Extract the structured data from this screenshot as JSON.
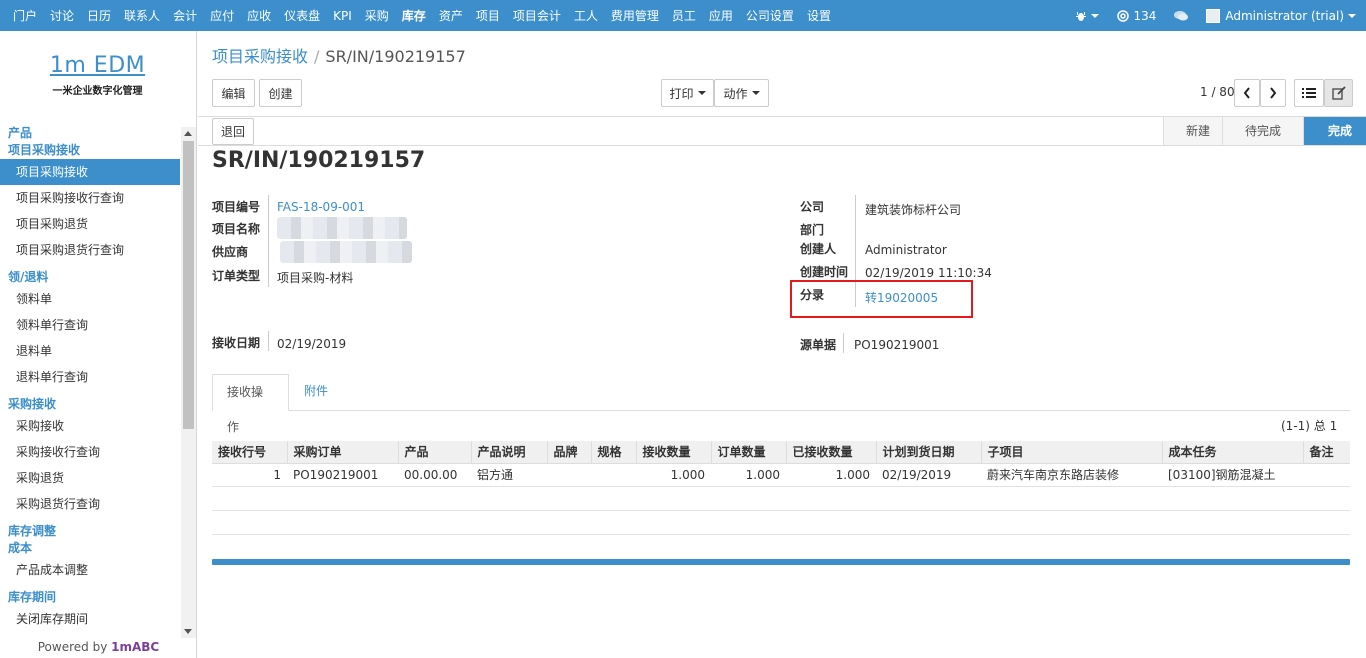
{
  "topnav": {
    "menu": [
      "门户",
      "讨论",
      "日历",
      "联系人",
      "会计",
      "应付",
      "应收",
      "仪表盘",
      "KPI",
      "采购",
      "库存",
      "资产",
      "项目",
      "项目会计",
      "工人",
      "费用管理",
      "员工",
      "应用",
      "公司设置",
      "设置"
    ],
    "active": "库存",
    "messages_count": "134",
    "user": "Administrator (trial)"
  },
  "logo": {
    "title": "1m EDM",
    "subtitle": "一米企业数字化管理"
  },
  "sidebar": {
    "groups": [
      {
        "label": "产品",
        "items": []
      },
      {
        "label": "项目采购接收",
        "items": [
          "项目采购接收",
          "项目采购接收行查询",
          "项目采购退货",
          "项目采购退货行查询"
        ]
      },
      {
        "label": "领/退料",
        "items": [
          "领料单",
          "领料单行查询",
          "退料单",
          "退料单行查询"
        ]
      },
      {
        "label": "采购接收",
        "items": [
          "采购接收",
          "采购接收行查询",
          "采购退货",
          "采购退货行查询"
        ]
      },
      {
        "label": "库存调整",
        "items": []
      },
      {
        "label": "成本",
        "items": [
          "产品成本调整"
        ]
      },
      {
        "label": "库存期间",
        "items": [
          "关闭库存期间"
        ]
      }
    ],
    "selected": "项目采购接收",
    "powered_prefix": "Powered by",
    "powered_brand": "1mABC"
  },
  "breadcrumb": {
    "parent": "项目采购接收",
    "current": "SR/IN/190219157"
  },
  "toolbar": {
    "edit": "编辑",
    "create": "创建",
    "print": "打印",
    "action": "动作",
    "pager": "1 / 80",
    "return_btn": "退回"
  },
  "status_steps": [
    "新建",
    "待完成",
    "完成"
  ],
  "status_active": "完成",
  "record": {
    "title": "SR/IN/190219157",
    "labels": {
      "project_no": "项目编号",
      "project_name": "项目名称",
      "supplier": "供应商",
      "order_type": "订单类型",
      "receive_date": "接收日期",
      "company": "公司",
      "department": "部门",
      "creator": "创建人",
      "created_at": "创建时间",
      "entry": "分录",
      "source_doc": "源单据"
    },
    "values": {
      "project_no": "FAS-18-09-001",
      "order_type": "项目采购-材料",
      "receive_date": "02/19/2019",
      "company": "建筑装饰标杆公司",
      "department": "",
      "creator": "Administrator",
      "created_at": "02/19/2019 11:10:34",
      "entry": "转19020005",
      "source_doc": "PO190219001"
    }
  },
  "tabs": [
    "接收操作",
    "附件"
  ],
  "tab_active": "接收操作",
  "grid": {
    "count": "(1-1) 总 1",
    "columns": [
      "接收行号",
      "采购订单",
      "产品",
      "产品说明",
      "品牌",
      "规格",
      "接收数量",
      "订单数量",
      "已接收数量",
      "计划到货日期",
      "子项目",
      "成本任务",
      "备注"
    ],
    "rows": [
      [
        "1",
        "PO190219001",
        "00.00.00",
        "铝方通",
        "",
        "",
        "1.000",
        "1.000",
        "1.000",
        "02/19/2019",
        "蔚来汽车南京东路店装修",
        "[03100]钢筋混凝土",
        ""
      ]
    ]
  },
  "colors": {
    "brand": "#3c8fcb",
    "highlight": "#e31a1c"
  }
}
